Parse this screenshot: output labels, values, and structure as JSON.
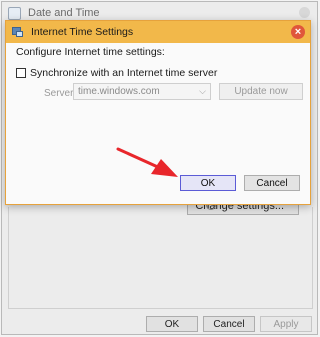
{
  "background_window": {
    "title": "Date and Time",
    "change_settings_label": "Change settings...",
    "ok_label": "OK",
    "cancel_label": "Cancel",
    "apply_label": "Apply"
  },
  "dialog": {
    "title": "Internet Time Settings",
    "close_glyph": "×",
    "configure_label": "Configure Internet time settings:",
    "sync_label": "Synchronize with an Internet time server",
    "sync_checked": false,
    "server_label": "Server:",
    "server_value": "time.windows.com",
    "update_label": "Update now",
    "ok_label": "OK",
    "cancel_label": "Cancel"
  },
  "colors": {
    "dialog_titlebar": "#f2b84a",
    "close_button": "#e0563b",
    "annotation_arrow": "#e8262b",
    "ok_focus_border": "#5b5bd6"
  },
  "icons": {
    "dialog_icon": "internet-time-icon",
    "background_app_icon": "date-time-app-icon",
    "chevron": "chevron-down-icon",
    "arrow": "annotation-arrow"
  }
}
